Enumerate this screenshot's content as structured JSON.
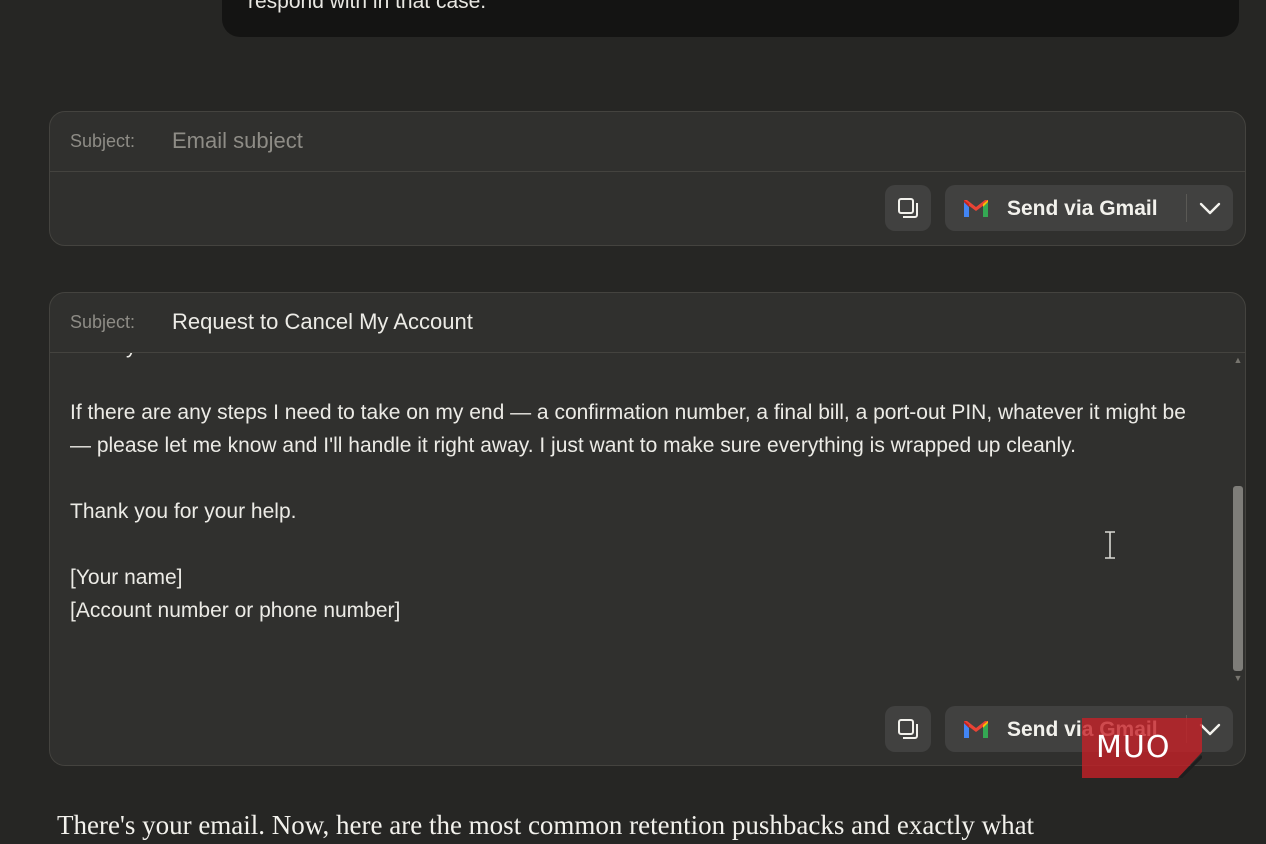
{
  "previous_message": {
    "text": "respond with in that case."
  },
  "drafts": [
    {
      "subject_label": "Subject:",
      "subject_value": "",
      "subject_placeholder": "Email subject",
      "copy_icon": "copy-icon",
      "send_label": "Send via Gmail",
      "send_icon": "gmail-icon",
      "dropdown_icon": "chevron-down-icon"
    },
    {
      "subject_label": "Subject:",
      "subject_value": "Request to Cancel My Account",
      "body": {
        "line_0": "directly.",
        "line_1": "If there are any steps I need to take on my end — a confirmation number, a final bill, a port-out PIN, whatever it might be — please let me know and I'll handle it right away. I just want to make sure everything is wrapped up cleanly.",
        "line_2": "Thank you for your help.",
        "line_3": "[Your name]",
        "line_4": "[Account number or phone number]"
      },
      "copy_icon": "copy-icon",
      "send_label": "Send via Gmail",
      "send_icon": "gmail-icon",
      "dropdown_icon": "chevron-down-icon"
    }
  ],
  "watermark": {
    "text": "MUO",
    "color": "#c42127"
  },
  "response_text": "There's your email. Now, here are the most common retention pushbacks and exactly what",
  "colors": {
    "background": "#262624",
    "card": "#30302e",
    "button": "#414140",
    "gmail_red": "#ea4335",
    "gmail_blue": "#4285f4",
    "gmail_green": "#34a853",
    "gmail_yellow": "#fbbc04"
  }
}
